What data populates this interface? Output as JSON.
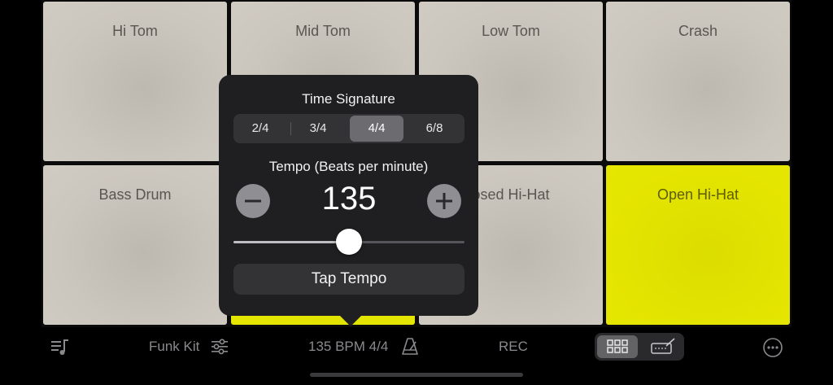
{
  "pads": [
    {
      "label": "Hi Tom",
      "color": "#c9c4bc"
    },
    {
      "label": "Mid Tom",
      "color": "#c9c4bc"
    },
    {
      "label": "Low Tom",
      "color": "#c9c4bc"
    },
    {
      "label": "Crash",
      "color": "#c9c4bc"
    },
    {
      "label": "Bass Drum",
      "color": "#c9c4bc"
    },
    {
      "label": "",
      "color": "#e2e300"
    },
    {
      "label": "osed Hi-Hat",
      "color": "#c9c4bc"
    },
    {
      "label": "Open Hi-Hat",
      "color": "#e2e300"
    }
  ],
  "popover": {
    "time_signature_title": "Time Signature",
    "time_signatures": [
      "2/4",
      "3/4",
      "4/4",
      "6/8"
    ],
    "selected_time_signature": "4/4",
    "tempo_title": "Tempo (Beats per minute)",
    "tempo_value": "135",
    "tempo_slider_fraction": 0.5,
    "tap_tempo_label": "Tap Tempo"
  },
  "toolbar": {
    "kit_name": "Funk Kit",
    "tempo_readout": "135 BPM 4/4",
    "rec_label": "REC"
  },
  "icons": {
    "library": "library-icon",
    "kit_settings": "sliders-icon",
    "metronome": "metronome-icon",
    "grid_view": "grid-icon",
    "editor_view": "editor-icon",
    "more": "more-icon"
  },
  "colors": {
    "pad_default": "#c9c4bc",
    "pad_active": "#e2e300",
    "popover_bg": "#1f1f21"
  }
}
